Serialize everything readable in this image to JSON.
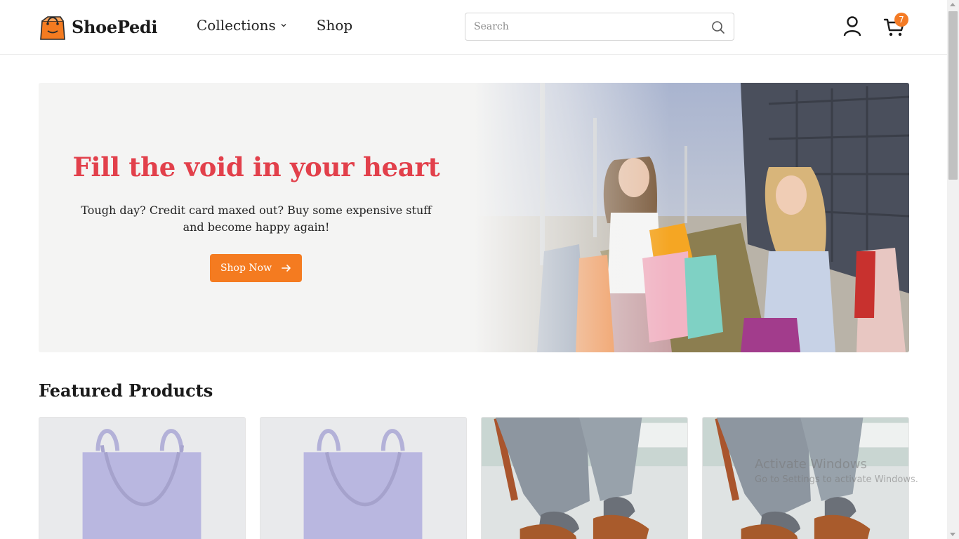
{
  "brand": {
    "name": "ShoePedi",
    "icon": "shopping-bag-icon",
    "color": "#f47b20"
  },
  "nav": {
    "items": [
      {
        "label": "Collections",
        "has_dropdown": true
      },
      {
        "label": "Shop",
        "has_dropdown": false
      }
    ]
  },
  "search": {
    "placeholder": "Search",
    "value": ""
  },
  "cart": {
    "count": "7",
    "badge_color": "#f47b25"
  },
  "hero": {
    "title": "Fill the void in your heart",
    "title_color": "#e2404b",
    "subtitle": "Tough day? Credit card maxed out? Buy some expensive stuff and become happy again!",
    "button_label": "Shop Now",
    "button_color": "#f47b20"
  },
  "featured": {
    "title": "Featured Products",
    "products": [
      {
        "image": "tote-bag"
      },
      {
        "image": "tote-bag"
      },
      {
        "image": "brown-shoes"
      },
      {
        "image": "brown-shoes"
      }
    ]
  },
  "watermark": {
    "line1": "Activate Windows",
    "line2": "Go to Settings to activate Windows."
  }
}
